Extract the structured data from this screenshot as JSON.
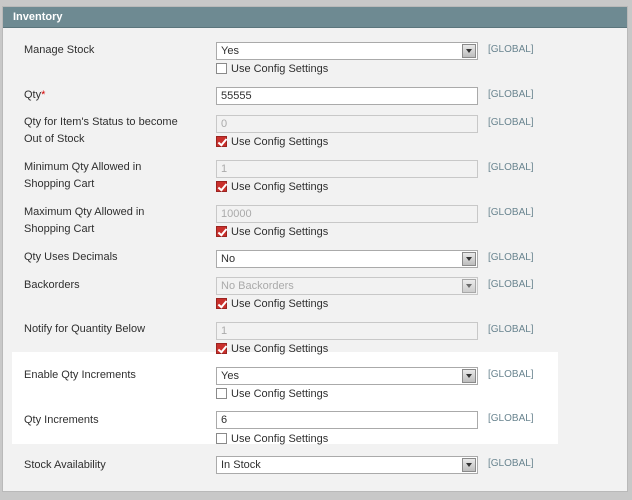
{
  "section": {
    "title": "Inventory"
  },
  "scope_label": "[GLOBAL]",
  "use_config_label": "Use Config Settings",
  "fields": {
    "manage_stock": {
      "label": "Manage Stock",
      "value": "Yes",
      "use_config": false
    },
    "qty": {
      "label": "Qty",
      "required_mark": "*",
      "value": "55555"
    },
    "out_of_stock_qty": {
      "label_line1": "Qty for Item's Status to become",
      "label_line2": "Out of Stock",
      "value": "0",
      "use_config": true
    },
    "min_sale_qty": {
      "label_line1": "Minimum Qty Allowed in",
      "label_line2": "Shopping Cart",
      "value": "1",
      "use_config": true
    },
    "max_sale_qty": {
      "label_line1": "Maximum Qty Allowed in",
      "label_line2": "Shopping Cart",
      "value": "10000",
      "use_config": true
    },
    "qty_uses_decimals": {
      "label": "Qty Uses Decimals",
      "value": "No"
    },
    "backorders": {
      "label": "Backorders",
      "value": "No Backorders",
      "use_config": true
    },
    "notify_qty_below": {
      "label": "Notify for Quantity Below",
      "value": "1",
      "use_config": true
    },
    "enable_qty_increments": {
      "label": "Enable Qty Increments",
      "value": "Yes",
      "use_config": false
    },
    "qty_increments": {
      "label": "Qty Increments",
      "value": "6",
      "use_config": false
    },
    "stock_availability": {
      "label": "Stock Availability",
      "value": "In Stock"
    }
  }
}
